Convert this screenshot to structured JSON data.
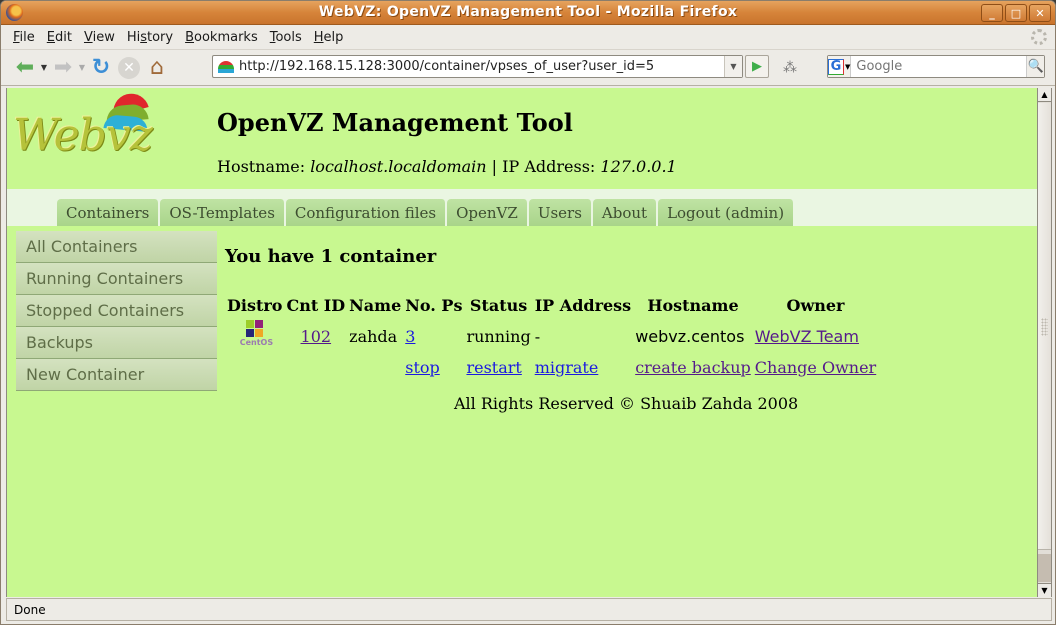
{
  "window": {
    "title": "WebVZ: OpenVZ Management Tool - Mozilla Firefox",
    "buttons": {
      "minimize": "_",
      "maximize": "□",
      "close": "✕"
    }
  },
  "menu": [
    {
      "label": "File",
      "accel": "F",
      "rest": "ile"
    },
    {
      "label": "Edit",
      "accel": "E",
      "rest": "dit"
    },
    {
      "label": "View",
      "accel": "V",
      "rest": "iew"
    },
    {
      "label": "History",
      "pre": "Hi",
      "accel": "s",
      "rest": "tory"
    },
    {
      "label": "Bookmarks",
      "accel": "B",
      "rest": "ookmarks"
    },
    {
      "label": "Tools",
      "accel": "T",
      "rest": "ools"
    },
    {
      "label": "Help",
      "accel": "H",
      "rest": "elp"
    }
  ],
  "toolbar": {
    "url": "http://192.168.15.128:3000/container/vpses_of_user?user_id=5",
    "search_placeholder": "Google",
    "search_engine": "G"
  },
  "page": {
    "site_title": "OpenVZ Management Tool",
    "logo_text": "Webvz",
    "host_label": "Hostname: ",
    "hostname": "localhost.localdomain",
    "separator": " | ",
    "ip_label": "IP Address: ",
    "ip": "127.0.0.1",
    "tabs": [
      "Containers",
      "OS-Templates",
      "Configuration files",
      "OpenVZ",
      "Users",
      "About",
      "Logout (admin)"
    ],
    "sidebar": [
      "All Containers",
      "Running Containers",
      "Stopped Containers",
      "Backups",
      "New Container"
    ],
    "heading": "You have 1 container",
    "table": {
      "columns": [
        "Distro",
        "Cnt ID",
        "Name",
        "No. Ps",
        "Status",
        "IP Address",
        "Hostname",
        "Owner"
      ],
      "rows": [
        {
          "distro": "CentOS",
          "cnt_id": "102",
          "name": "zahda",
          "num_ps": "3",
          "status": "running",
          "ip": "-",
          "hostname": "webvz.centos",
          "owner": "WebVZ Team",
          "actions": {
            "stop": "stop",
            "restart": "restart",
            "migrate": "migrate",
            "backup": "create backup",
            "change_owner": "Change Owner"
          }
        }
      ]
    },
    "footer": "All Rights Reserved © Shuaib Zahda 2008"
  },
  "status": "Done"
}
